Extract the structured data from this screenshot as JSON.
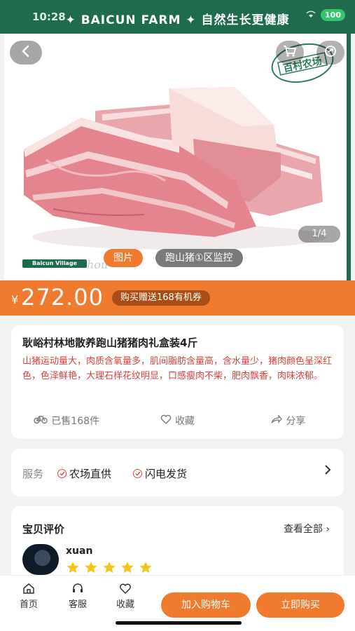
{
  "status_bar": {
    "time": "10:28",
    "battery": "100"
  },
  "banner": {
    "text": "✦ BAICUN FARM ✦ 自然生长更健康"
  },
  "gallery": {
    "counter": "1/4",
    "tabs": [
      "图片",
      "跑山猪①区监控"
    ],
    "stamp_text": "百村农场",
    "village_logo": "Baicun Village"
  },
  "price": {
    "currency": "¥",
    "amount": "272.00",
    "coupon": "购买赠送168有机券"
  },
  "product": {
    "title": "耿峪村林地散养跑山猪猪肉礼盒装4斤",
    "description": "山猪运动量大，肉质含氧量多，肌间脂肪含量高，含水量少，猪肉颜色呈深红色，色泽鲜艳，大理石样花纹明显，口感瘦肉不柴，肥肉飘香，肉味浓郁。",
    "sold": "已售168件",
    "favorite": "收藏",
    "share": "分享"
  },
  "service": {
    "label": "服务",
    "items": [
      "农场直供",
      "闪电发货"
    ]
  },
  "review": {
    "title": "宝贝评价",
    "view_all": "查看全部 ›",
    "reviewer": "xuan",
    "stars": 5
  },
  "bottom_nav": {
    "home": "首页",
    "service": "客服",
    "favorite": "收藏",
    "add_to_cart": "加入购物车",
    "buy_now": "立即购买"
  },
  "colors": {
    "brand_green": "#1f6b4e",
    "accent_orange": "#f07a2e",
    "desc_red": "#d94040",
    "star": "#f5c518"
  }
}
